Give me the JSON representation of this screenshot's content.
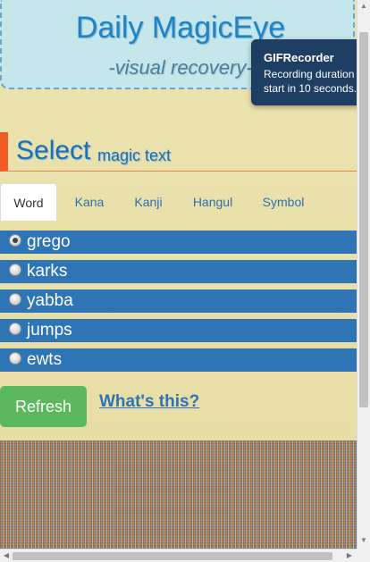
{
  "header": {
    "title": "Daily MagicEye",
    "subtitle": "-visual recovery-"
  },
  "select_heading": {
    "big": "Select",
    "small": "magic text"
  },
  "tabs": [
    {
      "label": "Word",
      "active": true
    },
    {
      "label": "Kana",
      "active": false
    },
    {
      "label": "Kanji",
      "active": false
    },
    {
      "label": "Hangul",
      "active": false
    },
    {
      "label": "Symbol",
      "active": false
    }
  ],
  "options": [
    {
      "label": "grego",
      "checked": true
    },
    {
      "label": "karks",
      "checked": false
    },
    {
      "label": "yabba",
      "checked": false
    },
    {
      "label": "jumps",
      "checked": false
    },
    {
      "label": "ewts",
      "checked": false
    }
  ],
  "actions": {
    "refresh_label": "Refresh",
    "whats_this_label": "What's this?"
  },
  "notification": {
    "title": "GIFRecorder",
    "message": "Recording duration start in 10 seconds."
  },
  "colors": {
    "accent": "#f15a22",
    "option_bg": "#2f74b5",
    "refresh_bg": "#5cb85c",
    "notification_bg": "#1e3f63",
    "header_bg": "#c5e6ea"
  },
  "icons": [
    "radio-icon",
    "scroll-arrow-up-icon",
    "scroll-arrow-down-icon",
    "scroll-arrow-left-icon",
    "scroll-arrow-right-icon"
  ]
}
